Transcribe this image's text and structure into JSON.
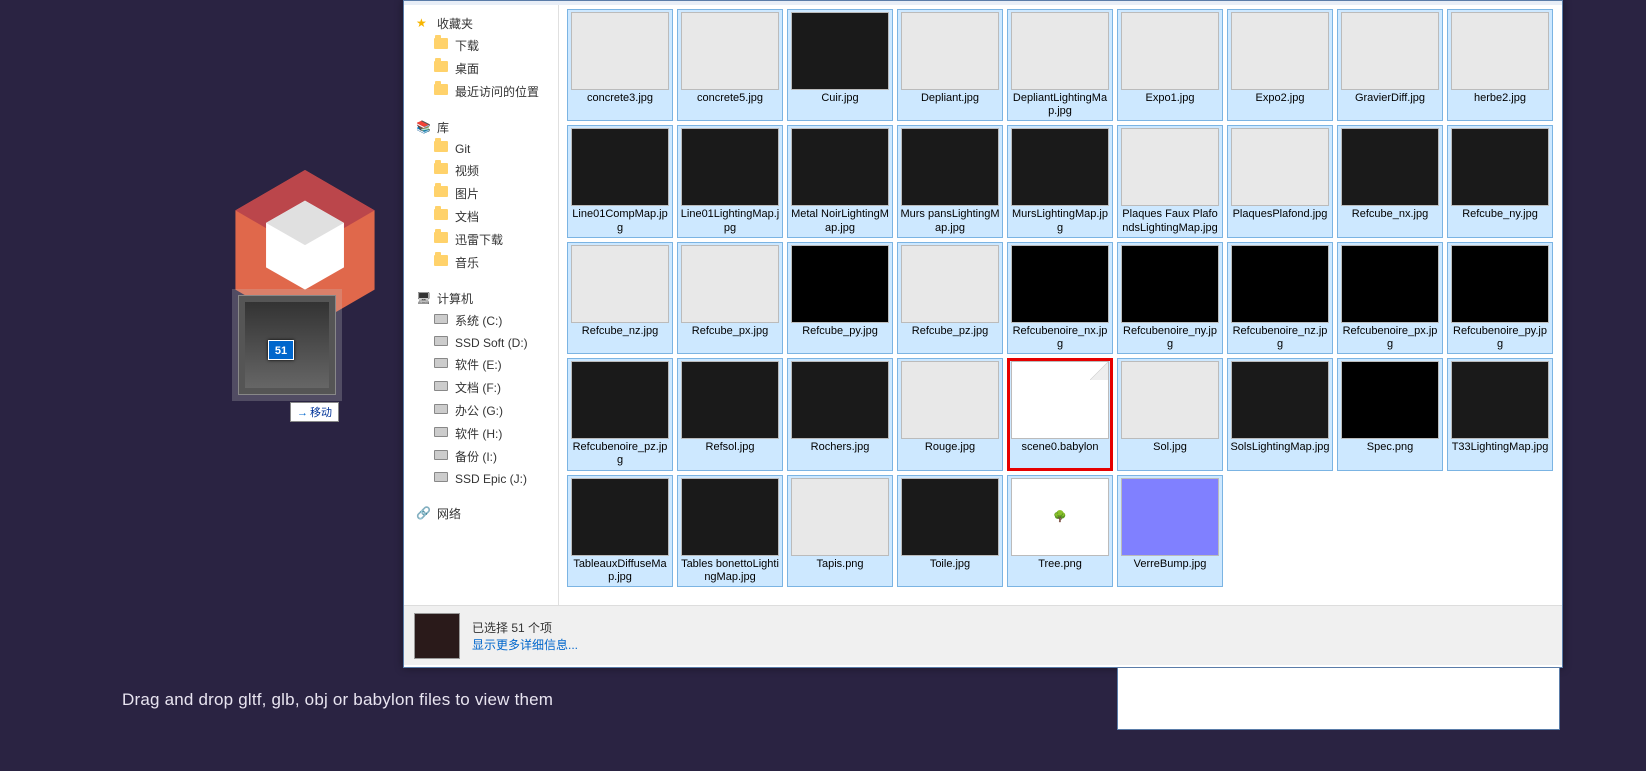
{
  "hint": "Drag and drop gltf, glb, obj or babylon files to view them",
  "drag": {
    "count": "51",
    "label": "移动"
  },
  "sidebar": {
    "favorites": {
      "title": "收藏夹",
      "items": [
        "下载",
        "桌面",
        "最近访问的位置"
      ]
    },
    "libraries": {
      "title": "库",
      "items": [
        "Git",
        "视频",
        "图片",
        "文档",
        "迅雷下载",
        "音乐"
      ]
    },
    "computer": {
      "title": "计算机",
      "items": [
        "系统 (C:)",
        "SSD Soft (D:)",
        "软件 (E:)",
        "文档 (F:)",
        "办公 (G:)",
        "软件 (H:)",
        "备份 (I:)",
        "SSD Epic (J:)"
      ]
    },
    "network": {
      "title": "网络"
    }
  },
  "files": [
    {
      "name": "concrete3.jpg",
      "t": "light"
    },
    {
      "name": "concrete5.jpg",
      "t": "light"
    },
    {
      "name": "Cuir.jpg",
      "t": "dark"
    },
    {
      "name": "Depliant.jpg",
      "t": "light"
    },
    {
      "name": "DepliantLightingMap.jpg",
      "t": "light"
    },
    {
      "name": "Expo1.jpg",
      "t": "light"
    },
    {
      "name": "Expo2.jpg",
      "t": "light"
    },
    {
      "name": "GravierDiff.jpg",
      "t": "light"
    },
    {
      "name": "herbe2.jpg",
      "t": "light"
    },
    {
      "name": "Line01CompMap.jpg",
      "t": "dark"
    },
    {
      "name": "Line01LightingMap.jpg",
      "t": "dark"
    },
    {
      "name": "Metal NoirLightingMap.jpg",
      "t": "dark"
    },
    {
      "name": "Murs pansLightingMap.jpg",
      "t": "dark"
    },
    {
      "name": "MursLightingMap.jpg",
      "t": "dark"
    },
    {
      "name": "Plaques Faux PlafondsLightingMap.jpg",
      "t": "light"
    },
    {
      "name": "PlaquesPlafond.jpg",
      "t": "light"
    },
    {
      "name": "Refcube_nx.jpg",
      "t": "dark"
    },
    {
      "name": "Refcube_ny.jpg",
      "t": "dark"
    },
    {
      "name": "Refcube_nz.jpg",
      "t": "light"
    },
    {
      "name": "Refcube_px.jpg",
      "t": "light"
    },
    {
      "name": "Refcube_py.jpg",
      "t": "black"
    },
    {
      "name": "Refcube_pz.jpg",
      "t": "light"
    },
    {
      "name": "Refcubenoire_nx.jpg",
      "t": "black"
    },
    {
      "name": "Refcubenoire_ny.jpg",
      "t": "black"
    },
    {
      "name": "Refcubenoire_nz.jpg",
      "t": "black"
    },
    {
      "name": "Refcubenoire_px.jpg",
      "t": "black"
    },
    {
      "name": "Refcubenoire_py.jpg",
      "t": "black"
    },
    {
      "name": "Refcubenoire_pz.jpg",
      "t": "dark"
    },
    {
      "name": "Refsol.jpg",
      "t": "dark"
    },
    {
      "name": "Rochers.jpg",
      "t": "dark"
    },
    {
      "name": "Rouge.jpg",
      "t": "light"
    },
    {
      "name": "scene0.babylon",
      "t": "doc",
      "hl": true
    },
    {
      "name": "Sol.jpg",
      "t": "light"
    },
    {
      "name": "SolsLightingMap.jpg",
      "t": "dark"
    },
    {
      "name": "Spec.png",
      "t": "black"
    },
    {
      "name": "T33LightingMap.jpg",
      "t": "dark"
    },
    {
      "name": "TableauxDiffuseMap.jpg",
      "t": "dark"
    },
    {
      "name": "Tables bonettoLightingMap.jpg",
      "t": "dark"
    },
    {
      "name": "Tapis.png",
      "t": "light"
    },
    {
      "name": "Toile.jpg",
      "t": "dark"
    },
    {
      "name": "Tree.png",
      "t": "tree"
    },
    {
      "name": "VerreBump.jpg",
      "t": "purple"
    }
  ],
  "status": {
    "selected": "已选择 51 个项",
    "more": "显示更多详细信息..."
  }
}
